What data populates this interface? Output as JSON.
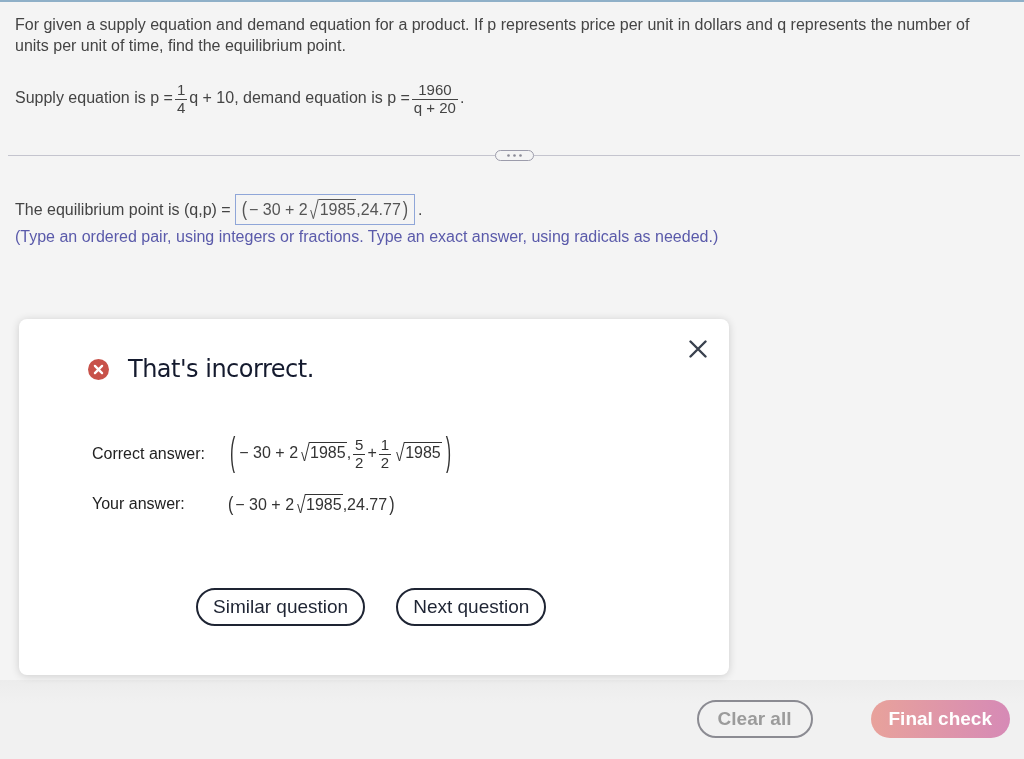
{
  "question": {
    "prompt": "For given a supply equation and demand equation for a product. If p represents price per unit in dollars and q represents the number of units per unit of time, find the equilibrium point.",
    "equation": [
      {
        "kind": "text",
        "text": "Supply equation is p ="
      },
      {
        "kind": "frac",
        "num": "1",
        "den": "4"
      },
      {
        "kind": "text",
        "text": "q + 10, demand equation is p ="
      },
      {
        "kind": "frac",
        "num": "1960",
        "den": "q + 20"
      },
      {
        "kind": "text",
        "text": "."
      }
    ]
  },
  "answer": {
    "label": "The equilibrium point is (q,p) =",
    "value": [
      {
        "kind": "paren",
        "open": "(",
        "close": ")",
        "items": [
          {
            "kind": "text",
            "text": "− 30 + 2"
          },
          {
            "kind": "sqrt",
            "radicand": "1985"
          },
          {
            "kind": "text",
            "text": ",24.77"
          }
        ]
      }
    ],
    "suffix": ".",
    "hint": "(Type an ordered pair, using integers or fractions. Type an exact answer, using radicals as needed.)"
  },
  "feedback": {
    "correct": false,
    "title": "That's incorrect.",
    "rows": [
      {
        "label": "Correct answer:",
        "math": [
          {
            "kind": "paren",
            "open": "(",
            "close": ")",
            "items": [
              {
                "kind": "text",
                "text": "− 30 + 2"
              },
              {
                "kind": "sqrt",
                "radicand": "1985"
              },
              {
                "kind": "text",
                "text": ","
              },
              {
                "kind": "frac",
                "num": "5",
                "den": "2"
              },
              {
                "kind": "text",
                "text": "+"
              },
              {
                "kind": "frac",
                "num": "1",
                "den": "2"
              },
              {
                "kind": "sqrt",
                "radicand": "1985"
              }
            ]
          }
        ]
      },
      {
        "label": "Your answer:",
        "math": [
          {
            "kind": "paren",
            "open": "(",
            "close": ")",
            "items": [
              {
                "kind": "text",
                "text": "− 30 + 2"
              },
              {
                "kind": "sqrt",
                "radicand": "1985"
              },
              {
                "kind": "text",
                "text": ",24.77"
              }
            ]
          }
        ]
      }
    ],
    "buttons": [
      "Similar question",
      "Next question"
    ]
  },
  "footer": {
    "buttons": [
      {
        "label": "Clear all",
        "kind": "outline",
        "disabled": true
      },
      {
        "label": "Final check",
        "kind": "primary",
        "disabled": true
      }
    ]
  }
}
